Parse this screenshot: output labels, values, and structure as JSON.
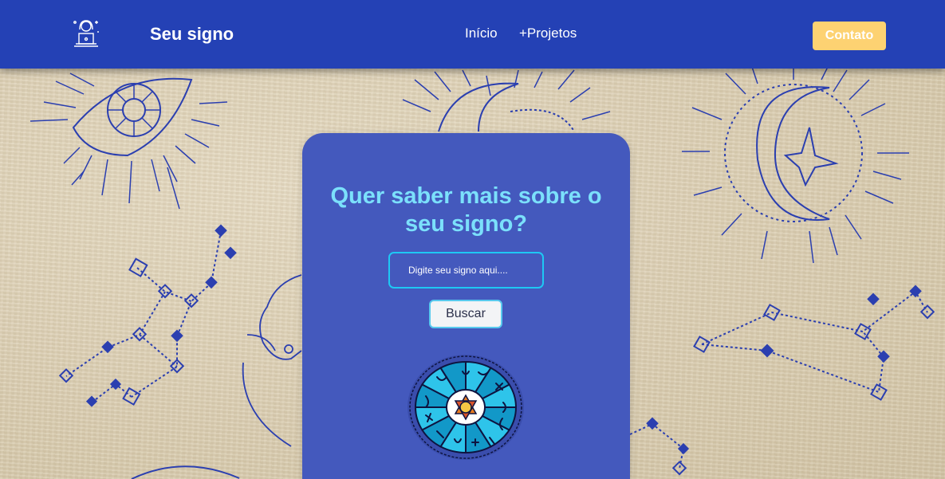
{
  "header": {
    "logo_icon": "astrologer-icon",
    "brand": "Seu signo",
    "nav": [
      {
        "label": "Início"
      },
      {
        "label": "+Projetos"
      }
    ],
    "contact_label": "Contato"
  },
  "card": {
    "title": "Quer saber mais sobre o seu signo?",
    "search": {
      "placeholder": "Digite seu signo aqui....",
      "value": ""
    },
    "search_button": "Buscar",
    "wheel_icon": "zodiac-wheel-icon"
  },
  "colors": {
    "header": "#2441b5",
    "card": "#4459bd",
    "title": "#7be0fb",
    "accent_button": "#fdd272",
    "input_border": "#1ec8f4",
    "paper": "#ddd0b4",
    "line_art": "#2b3fb0"
  }
}
